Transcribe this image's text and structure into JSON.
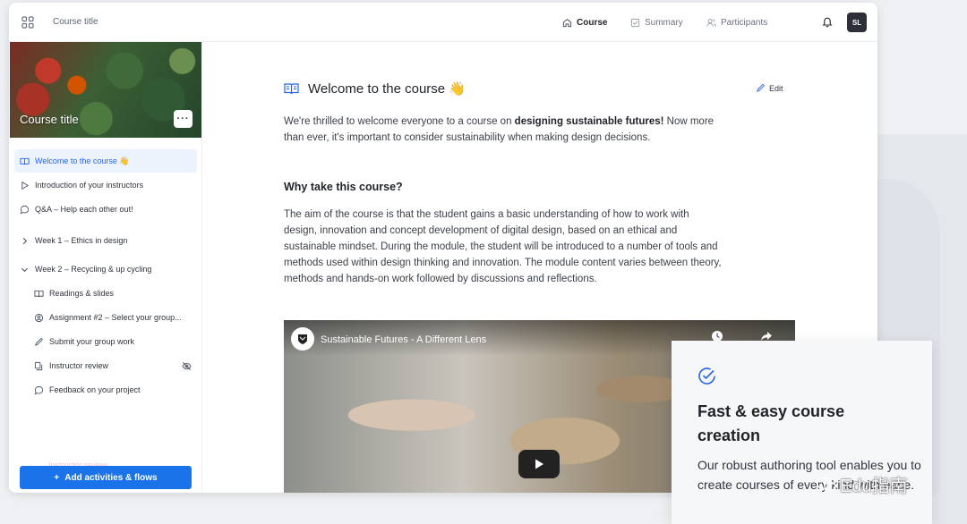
{
  "colors": {
    "accent": "#1a73e8",
    "active_bg": "#edf3fd",
    "active_text": "#2563eb",
    "avatar_bg": "#2d3038"
  },
  "header": {
    "course_title": "Course title",
    "tabs": [
      {
        "label": "Course",
        "icon": "home-icon",
        "active": true
      },
      {
        "label": "Summary",
        "icon": "checkbox-icon",
        "active": false
      },
      {
        "label": "Participants",
        "icon": "users-icon",
        "active": false
      }
    ],
    "avatar_initials": "SL"
  },
  "sidebar": {
    "cover_title": "Course title",
    "more_label": "···",
    "items": [
      {
        "label": "Welcome to the course 👋",
        "icon": "book-icon",
        "active": true
      },
      {
        "label": "Introduction of your instructors",
        "icon": "play-icon"
      },
      {
        "label": "Q&A – Help each other out!",
        "icon": "chat-icon"
      },
      {
        "label": "Week 1 – Ethics in design",
        "icon": "chevron-right-icon"
      },
      {
        "label": "Week 2 – Recycling & up cycling",
        "icon": "chevron-down-icon"
      },
      {
        "label": "Readings & slides",
        "icon": "book-icon"
      },
      {
        "label": "Assignment #2 – Select your group...",
        "icon": "group-icon"
      },
      {
        "label": "Submit your group work",
        "icon": "pen-icon"
      },
      {
        "label": "Instructor review",
        "icon": "review-icon",
        "hidden": true
      },
      {
        "label": "Feedback on your project",
        "icon": "chat-icon"
      }
    ],
    "ghost_label": "Instructor review",
    "add_button": "Add activities & flows"
  },
  "main": {
    "title": "Welcome to the course 👋",
    "edit_label": "Edit",
    "intro_before": "We're thrilled to welcome everyone to a course on ",
    "intro_bold": "designing sustainable futures!",
    "intro_after": " Now more than ever, it's important to consider sustainability when making design decisions.",
    "section_heading": "Why take this course?",
    "section_body": "The aim of the course is that the student gains a basic understanding of how to work with design, innovation and concept development of digital design, based on an ethical and sustainable mindset. During the module, the student will be introduced to a number of tools and methods used within design thinking and innovation. The module content varies between theory, methods and hands-on work followed by discussions and reflections.",
    "video_title": "Sustainable Futures - A Different Lens"
  },
  "promo": {
    "title": "Fast & easy course creation",
    "body": "Our robust authoring tool enables you to create courses of every kind with ease."
  },
  "watermark": "Edu指南"
}
